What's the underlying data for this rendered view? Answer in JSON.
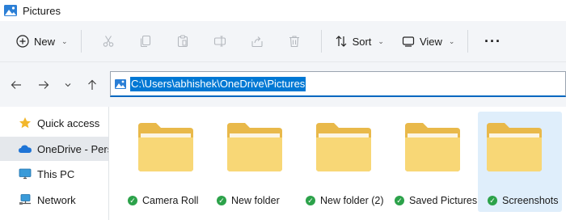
{
  "window": {
    "title": "Pictures"
  },
  "toolbar": {
    "new_label": "New",
    "sort_label": "Sort",
    "view_label": "View"
  },
  "address": {
    "path": "C:\\Users\\abhishek\\OneDrive\\Pictures"
  },
  "sidebar": {
    "items": [
      {
        "label": "Quick access",
        "icon": "star-icon"
      },
      {
        "label": "OneDrive - Perso",
        "icon": "cloud-icon",
        "selected": true
      },
      {
        "label": "This PC",
        "icon": "monitor-icon"
      },
      {
        "label": "Network",
        "icon": "network-icon"
      }
    ]
  },
  "folders": [
    {
      "name": "Camera Roll",
      "status": "synced"
    },
    {
      "name": "New folder",
      "status": "synced"
    },
    {
      "name": "New folder (2)",
      "status": "synced"
    },
    {
      "name": "Saved Pictures",
      "status": "synced"
    },
    {
      "name": "Screenshots",
      "status": "synced",
      "selected": true
    }
  ],
  "colors": {
    "accent": "#0078d4",
    "toolbar_bg": "#f3f5f8",
    "folder_yellow": "#f8d776",
    "sync_green": "#2ca24a"
  }
}
